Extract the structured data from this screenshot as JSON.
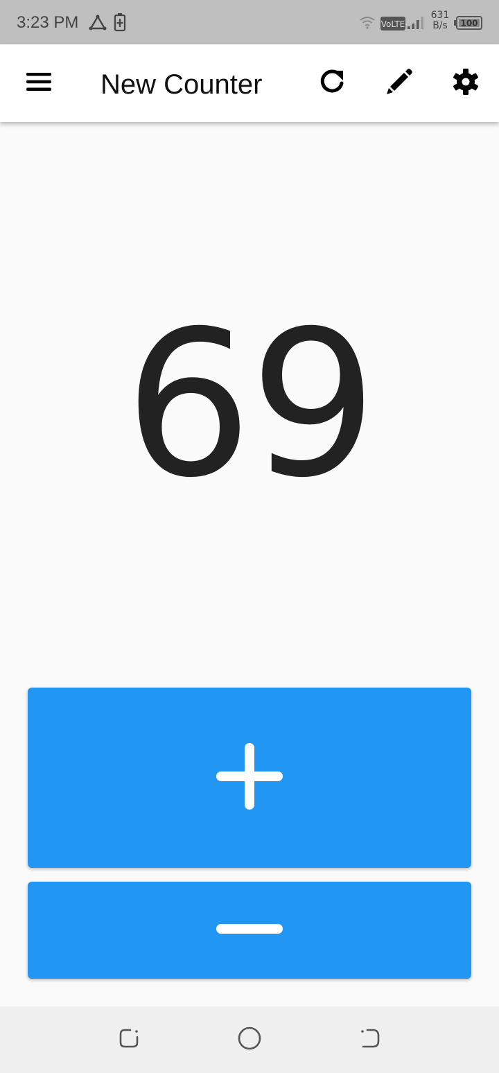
{
  "status_bar": {
    "time": "3:23 PM",
    "net_speed_value": "631",
    "net_speed_unit": "B/s",
    "volte_label": "VoLTE",
    "battery_level": "100",
    "icons": [
      "triangle-app-icon",
      "battery-charging-icon",
      "wifi-icon",
      "volte-icon",
      "signal-icon",
      "battery-icon"
    ]
  },
  "app_bar": {
    "title": "New Counter",
    "icons": [
      "menu-icon",
      "reset-icon",
      "edit-icon",
      "settings-icon"
    ]
  },
  "counter": {
    "value": "69"
  },
  "buttons": {
    "increment_icon": "plus-icon",
    "decrement_icon": "minus-icon"
  },
  "nav_bar": {
    "icons": [
      "recent-apps-icon",
      "home-icon",
      "back-icon"
    ]
  },
  "colors": {
    "status_bar_bg": "#bfbfbf",
    "app_bar_bg": "#ffffff",
    "background": "#fafafa",
    "button_blue": "#2196f3",
    "nav_bar_bg": "#efefef"
  }
}
